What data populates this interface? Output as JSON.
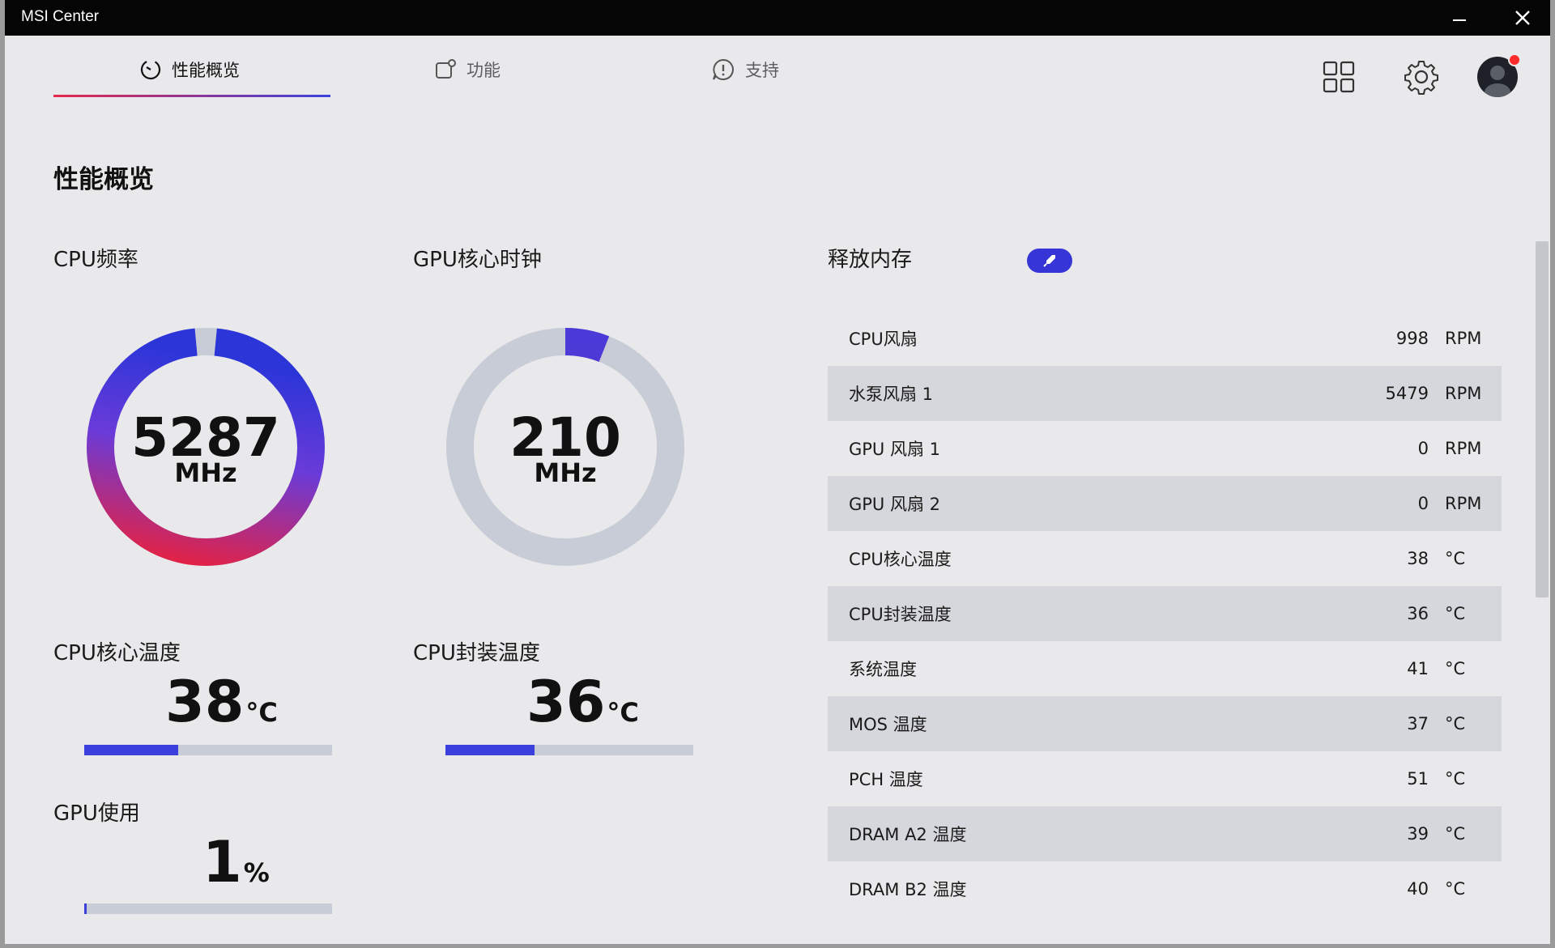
{
  "window": {
    "title": "MSI Center"
  },
  "nav": {
    "tabs": [
      {
        "label": "性能概览",
        "icon": "gauge-icon",
        "active": true
      },
      {
        "label": "功能",
        "icon": "feature-icon",
        "active": false
      },
      {
        "label": "支持",
        "icon": "support-icon",
        "active": false
      }
    ]
  },
  "page": {
    "title": "性能概览"
  },
  "gauges": {
    "cpu": {
      "label": "CPU频率",
      "value": "5287",
      "unit": "MHz",
      "level": 0.97
    },
    "gpu": {
      "label": "GPU核心时钟",
      "value": "210",
      "unit": "MHz",
      "level": 0.06
    }
  },
  "metrics": {
    "cpu_core_temp": {
      "label": "CPU核心温度",
      "value": "38",
      "unit": "°C",
      "level": 0.38
    },
    "cpu_pkg_temp": {
      "label": "CPU封装温度",
      "value": "36",
      "unit": "°C",
      "level": 0.36
    },
    "gpu_usage": {
      "label": "GPU使用",
      "value": "1",
      "unit": "%",
      "level": 0.01
    }
  },
  "memory": {
    "label": "释放内存"
  },
  "sensors": [
    {
      "name": "CPU风扇",
      "value": "998",
      "unit": "RPM"
    },
    {
      "name": "水泵风扇 1",
      "value": "5479",
      "unit": "RPM"
    },
    {
      "name": "GPU 风扇 1",
      "value": "0",
      "unit": "RPM"
    },
    {
      "name": "GPU 风扇 2",
      "value": "0",
      "unit": "RPM"
    },
    {
      "name": "CPU核心温度",
      "value": "38",
      "unit": "°C"
    },
    {
      "name": "CPU封装温度",
      "value": "36",
      "unit": "°C"
    },
    {
      "name": "系统温度",
      "value": "41",
      "unit": "°C"
    },
    {
      "name": "MOS 温度",
      "value": "37",
      "unit": "°C"
    },
    {
      "name": "PCH 温度",
      "value": "51",
      "unit": "°C"
    },
    {
      "name": "DRAM A2 温度",
      "value": "39",
      "unit": "°C"
    },
    {
      "name": "DRAM B2 温度",
      "value": "40",
      "unit": "°C"
    }
  ],
  "colors": {
    "accent_blue": "#3b3fdc",
    "accent_red": "#e5294b",
    "gauge_track": "#c8ccd6",
    "gpu_gauge_fill": "#7a35c8"
  }
}
